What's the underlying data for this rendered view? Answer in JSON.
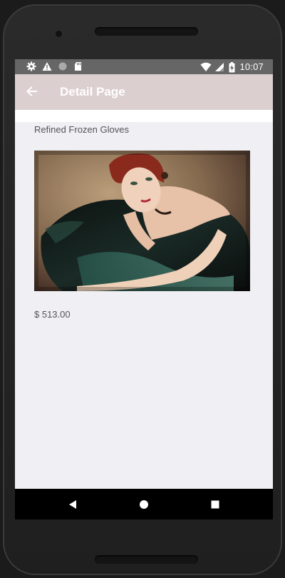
{
  "status_bar": {
    "time": "10:07",
    "left_icons": [
      "settings-icon",
      "warning-icon",
      "circle-icon",
      "sd-card-icon"
    ],
    "right_icons": [
      "wifi-icon",
      "signal-icon",
      "battery-charging-icon"
    ]
  },
  "app_bar": {
    "title": "Detail Page",
    "back_icon": "arrow-back-icon"
  },
  "product": {
    "name": "Refined Frozen Gloves",
    "price": "$ 513.00"
  },
  "nav_bar": {
    "icons": [
      "nav-back-icon",
      "nav-home-icon",
      "nav-recents-icon"
    ]
  },
  "colors": {
    "status_bar": "#666666",
    "app_bar": "#dccfcf",
    "content_bg": "#efeff4",
    "nav_bar": "#000000"
  }
}
